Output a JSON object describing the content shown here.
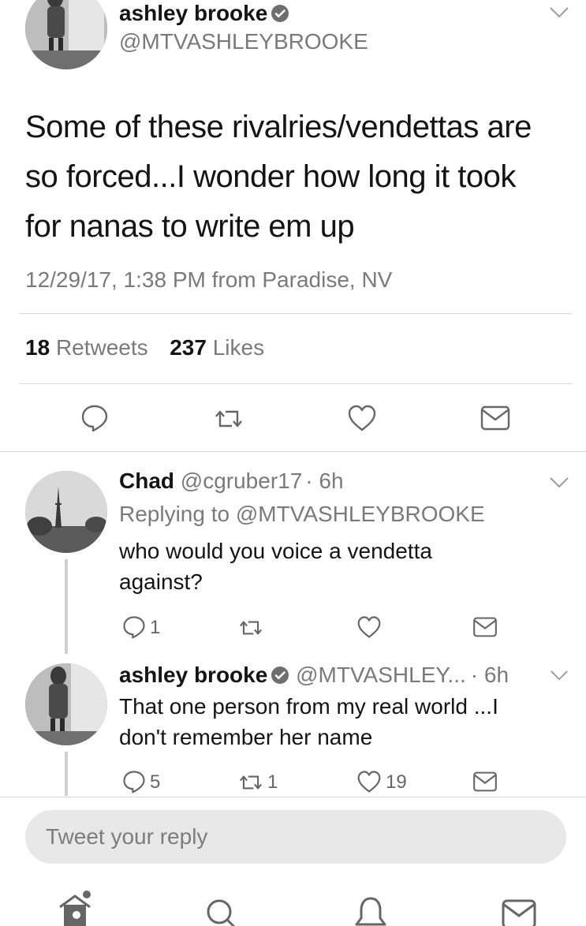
{
  "main_tweet": {
    "display_name": "ashley brooke",
    "handle": "@MTVASHLEYBROOKE",
    "text_lines": [
      "Some of these rivalries/vendettas are",
      "so forced...I wonder how long it took",
      "for nanas to write em up"
    ],
    "timestamp": "12/29/17, 1:38 PM from Paradise, NV",
    "retweets_count": "18",
    "retweets_label": "Retweets",
    "likes_count": "237",
    "likes_label": "Likes"
  },
  "replies": [
    {
      "display_name": "Chad",
      "handle": "@cgruber17",
      "time": "· 6h",
      "replying_to_label": "Replying to",
      "replying_to_handle": "@MTVASHLEYBROOKE",
      "text_lines": [
        "who would you voice a vendetta",
        "against?"
      ],
      "reply_count": "1",
      "retweet_count": "",
      "like_count": ""
    },
    {
      "display_name": "ashley brooke",
      "handle": "@MTVASHLEY...",
      "time": "· 6h",
      "text_lines": [
        "That one person from my real world ...I",
        "don't remember her name"
      ],
      "reply_count": "5",
      "retweet_count": "1",
      "like_count": "19"
    }
  ],
  "reply_box": {
    "placeholder": "Tweet your reply"
  },
  "bottom_nav": {
    "icons": [
      "home-icon",
      "search-icon",
      "notifications-icon",
      "messages-icon"
    ]
  },
  "colors": {
    "text": "#141414",
    "secondary": "#7a7a7a",
    "divider": "#d6d6d6",
    "reply_box_bg": "#e8e8e8"
  }
}
